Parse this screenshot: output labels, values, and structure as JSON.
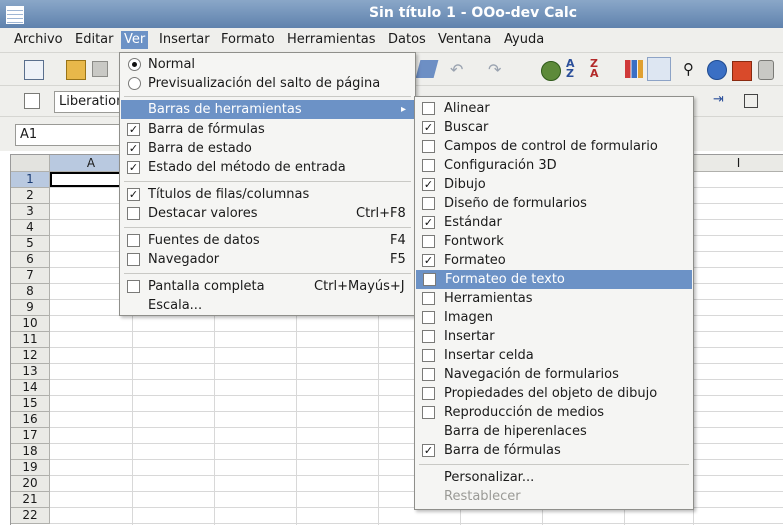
{
  "window": {
    "title": "Sin título 1 - OOo-dev Calc"
  },
  "menubar": [
    "Archivo",
    "Editar",
    "Ver",
    "Insertar",
    "Formato",
    "Herramientas",
    "Datos",
    "Ventana",
    "Ayuda"
  ],
  "formatting": {
    "font_name": "Liberation Sans"
  },
  "namebox": {
    "value": "A1"
  },
  "sheet": {
    "columns": [
      "A",
      "I"
    ],
    "rows": [
      "1",
      "2",
      "3",
      "4",
      "5",
      "6",
      "7",
      "8",
      "9",
      "10",
      "11",
      "12",
      "13",
      "14",
      "15",
      "16",
      "17",
      "18",
      "19",
      "20",
      "21",
      "22"
    ]
  },
  "view_menu": {
    "items": [
      {
        "label": "Normal",
        "type": "radio",
        "checked": true
      },
      {
        "label": "Previsualización del salto de página",
        "type": "radio",
        "checked": false
      },
      {
        "label": "Barras de herramientas",
        "type": "submenu"
      },
      {
        "label": "Barra de fórmulas",
        "type": "check",
        "checked": true
      },
      {
        "label": "Barra de estado",
        "type": "check",
        "checked": true
      },
      {
        "label": "Estado del método de entrada",
        "type": "check",
        "checked": true
      },
      {
        "label": "Títulos de filas/columnas",
        "type": "check",
        "checked": true
      },
      {
        "label": "Destacar valores",
        "type": "check",
        "checked": false,
        "shortcut": "Ctrl+F8"
      },
      {
        "label": "Fuentes de datos",
        "type": "check",
        "checked": false,
        "shortcut": "F4"
      },
      {
        "label": "Navegador",
        "type": "check",
        "checked": false,
        "shortcut": "F5"
      },
      {
        "label": "Pantalla completa",
        "type": "check",
        "checked": false,
        "shortcut": "Ctrl+Mayús+J"
      },
      {
        "label": "Escala...",
        "type": "plain"
      }
    ]
  },
  "toolbars_submenu": {
    "items": [
      {
        "label": "Alinear",
        "checked": false
      },
      {
        "label": "Buscar",
        "checked": true
      },
      {
        "label": "Campos de control de formulario",
        "checked": false
      },
      {
        "label": "Configuración 3D",
        "checked": false
      },
      {
        "label": "Dibujo",
        "checked": true
      },
      {
        "label": "Diseño de formularios",
        "checked": false
      },
      {
        "label": "Estándar",
        "checked": true
      },
      {
        "label": "Fontwork",
        "checked": false
      },
      {
        "label": "Formateo",
        "checked": true
      },
      {
        "label": "Formateo de texto",
        "checked": false,
        "highlighted": true
      },
      {
        "label": "Herramientas",
        "checked": false
      },
      {
        "label": "Imagen",
        "checked": false
      },
      {
        "label": "Insertar",
        "checked": false
      },
      {
        "label": "Insertar celda",
        "checked": false
      },
      {
        "label": "Navegación de formularios",
        "checked": false
      },
      {
        "label": "Propiedades del objeto de dibujo",
        "checked": false
      },
      {
        "label": "Reproducción de medios",
        "checked": false
      },
      {
        "label": "Barra de hiperenlaces",
        "checked": null
      },
      {
        "label": "Barra de fórmulas",
        "checked": true
      },
      {
        "label": "Personalizar...",
        "checked": null
      },
      {
        "label": "Restablecer",
        "checked": null,
        "disabled": true
      }
    ]
  },
  "colors": {
    "menu_highlight": "#6c92c6",
    "titlebar": "#6f8fb8"
  }
}
